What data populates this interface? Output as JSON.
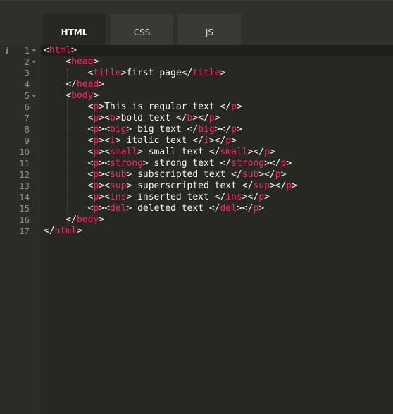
{
  "tabs": [
    {
      "label": "HTML",
      "active": true
    },
    {
      "label": "CSS",
      "active": false
    },
    {
      "label": "JS",
      "active": false
    }
  ],
  "gutter": {
    "info_icon": "i",
    "line_numbers": [
      "1",
      "2",
      "3",
      "4",
      "5",
      "6",
      "7",
      "8",
      "9",
      "10",
      "11",
      "12",
      "13",
      "14",
      "15",
      "16",
      "17"
    ],
    "fold_markers_on_lines": [
      1,
      2,
      5
    ]
  },
  "colors": {
    "tag": "#f92672",
    "text": "#f8f8f2",
    "background": "#272822",
    "gutter": "#2b2b27"
  },
  "code_lines": [
    [
      [
        "p",
        "<"
      ],
      [
        "t",
        "html"
      ],
      [
        "p",
        ">"
      ]
    ],
    [
      [
        "x",
        "    "
      ],
      [
        "p",
        "<"
      ],
      [
        "t",
        "head"
      ],
      [
        "p",
        ">"
      ]
    ],
    [
      [
        "x",
        "        "
      ],
      [
        "p",
        "<"
      ],
      [
        "t",
        "title"
      ],
      [
        "p",
        ">"
      ],
      [
        "x",
        "first page"
      ],
      [
        "p",
        "</"
      ],
      [
        "t",
        "title"
      ],
      [
        "p",
        ">"
      ]
    ],
    [
      [
        "x",
        "    "
      ],
      [
        "p",
        "</"
      ],
      [
        "t",
        "head"
      ],
      [
        "p",
        ">"
      ]
    ],
    [
      [
        "x",
        "    "
      ],
      [
        "p",
        "<"
      ],
      [
        "t",
        "body"
      ],
      [
        "p",
        ">"
      ]
    ],
    [
      [
        "x",
        "        "
      ],
      [
        "p",
        "<"
      ],
      [
        "t",
        "p"
      ],
      [
        "p",
        ">"
      ],
      [
        "x",
        "This is regular text "
      ],
      [
        "p",
        "</"
      ],
      [
        "t",
        "p"
      ],
      [
        "p",
        ">"
      ]
    ],
    [
      [
        "x",
        "        "
      ],
      [
        "p",
        "<"
      ],
      [
        "t",
        "p"
      ],
      [
        "p",
        "><"
      ],
      [
        "t",
        "b"
      ],
      [
        "p",
        ">"
      ],
      [
        "x",
        "bold text "
      ],
      [
        "p",
        "</"
      ],
      [
        "t",
        "b"
      ],
      [
        "p",
        "></"
      ],
      [
        "t",
        "p"
      ],
      [
        "p",
        ">"
      ]
    ],
    [
      [
        "x",
        "        "
      ],
      [
        "p",
        "<"
      ],
      [
        "t",
        "p"
      ],
      [
        "p",
        "><"
      ],
      [
        "t",
        "big"
      ],
      [
        "p",
        ">"
      ],
      [
        "x",
        " big text "
      ],
      [
        "p",
        "</"
      ],
      [
        "t",
        "big"
      ],
      [
        "p",
        "></"
      ],
      [
        "t",
        "p"
      ],
      [
        "p",
        ">"
      ]
    ],
    [
      [
        "x",
        "        "
      ],
      [
        "p",
        "<"
      ],
      [
        "t",
        "p"
      ],
      [
        "p",
        "><"
      ],
      [
        "t",
        "i"
      ],
      [
        "p",
        ">"
      ],
      [
        "x",
        " italic text "
      ],
      [
        "p",
        "</"
      ],
      [
        "t",
        "i"
      ],
      [
        "p",
        "></"
      ],
      [
        "t",
        "p"
      ],
      [
        "p",
        ">"
      ]
    ],
    [
      [
        "x",
        "        "
      ],
      [
        "p",
        "<"
      ],
      [
        "t",
        "p"
      ],
      [
        "p",
        "><"
      ],
      [
        "t",
        "small"
      ],
      [
        "p",
        ">"
      ],
      [
        "x",
        " small text "
      ],
      [
        "p",
        "</"
      ],
      [
        "t",
        "small"
      ],
      [
        "p",
        "></"
      ],
      [
        "t",
        "p"
      ],
      [
        "p",
        ">"
      ]
    ],
    [
      [
        "x",
        "        "
      ],
      [
        "p",
        "<"
      ],
      [
        "t",
        "p"
      ],
      [
        "p",
        "><"
      ],
      [
        "t",
        "strong"
      ],
      [
        "p",
        ">"
      ],
      [
        "x",
        " strong text "
      ],
      [
        "p",
        "</"
      ],
      [
        "t",
        "strong"
      ],
      [
        "p",
        "></"
      ],
      [
        "t",
        "p"
      ],
      [
        "p",
        ">"
      ]
    ],
    [
      [
        "x",
        "        "
      ],
      [
        "p",
        "<"
      ],
      [
        "t",
        "p"
      ],
      [
        "p",
        "><"
      ],
      [
        "t",
        "sub"
      ],
      [
        "p",
        ">"
      ],
      [
        "x",
        " subscripted text "
      ],
      [
        "p",
        "</"
      ],
      [
        "t",
        "sub"
      ],
      [
        "p",
        "></"
      ],
      [
        "t",
        "p"
      ],
      [
        "p",
        ">"
      ]
    ],
    [
      [
        "x",
        "        "
      ],
      [
        "p",
        "<"
      ],
      [
        "t",
        "p"
      ],
      [
        "p",
        "><"
      ],
      [
        "t",
        "sup"
      ],
      [
        "p",
        ">"
      ],
      [
        "x",
        " superscripted text "
      ],
      [
        "p",
        "</"
      ],
      [
        "t",
        "sup"
      ],
      [
        "p",
        "></"
      ],
      [
        "t",
        "p"
      ],
      [
        "p",
        ">"
      ]
    ],
    [
      [
        "x",
        "        "
      ],
      [
        "p",
        "<"
      ],
      [
        "t",
        "p"
      ],
      [
        "p",
        "><"
      ],
      [
        "t",
        "ins"
      ],
      [
        "p",
        ">"
      ],
      [
        "x",
        " inserted text "
      ],
      [
        "p",
        "</"
      ],
      [
        "t",
        "ins"
      ],
      [
        "p",
        "></"
      ],
      [
        "t",
        "p"
      ],
      [
        "p",
        ">"
      ]
    ],
    [
      [
        "x",
        "        "
      ],
      [
        "p",
        "<"
      ],
      [
        "t",
        "p"
      ],
      [
        "p",
        "><"
      ],
      [
        "t",
        "del"
      ],
      [
        "p",
        ">"
      ],
      [
        "x",
        " deleted text "
      ],
      [
        "p",
        "</"
      ],
      [
        "t",
        "del"
      ],
      [
        "p",
        "></"
      ],
      [
        "t",
        "p"
      ],
      [
        "p",
        ">"
      ]
    ],
    [
      [
        "x",
        "    "
      ],
      [
        "p",
        "</"
      ],
      [
        "t",
        "body"
      ],
      [
        "p",
        ">"
      ]
    ],
    [
      [
        "p",
        "</"
      ],
      [
        "t",
        "html"
      ],
      [
        "p",
        ">"
      ]
    ]
  ]
}
